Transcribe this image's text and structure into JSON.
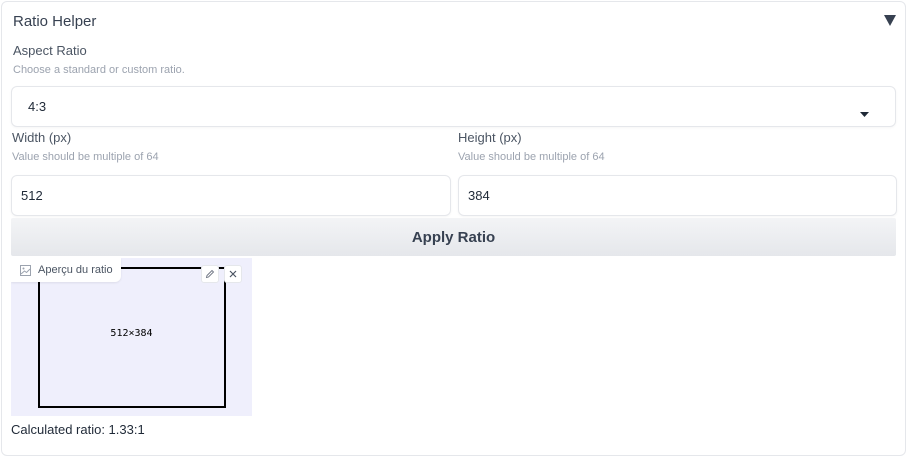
{
  "panel": {
    "title": "Ratio Helper",
    "toggle_icon": "triangle-down-icon"
  },
  "aspect": {
    "label": "Aspect Ratio",
    "info": "Choose a standard or custom ratio.",
    "selected": "4:3"
  },
  "width": {
    "label": "Width (px)",
    "info": "Value should be multiple of 64",
    "value": "512"
  },
  "height": {
    "label": "Height (px)",
    "info": "Value should be multiple of 64",
    "value": "384"
  },
  "apply_label": "Apply Ratio",
  "preview": {
    "label": "Aperçu du ratio",
    "text": "512×384",
    "icons": [
      "image-icon",
      "edit-icon",
      "close-icon"
    ]
  },
  "calculated": "Calculated ratio: 1.33:1",
  "colors": {
    "preview_bg": "#efeffc",
    "button_bg": "#e5e7eb"
  }
}
